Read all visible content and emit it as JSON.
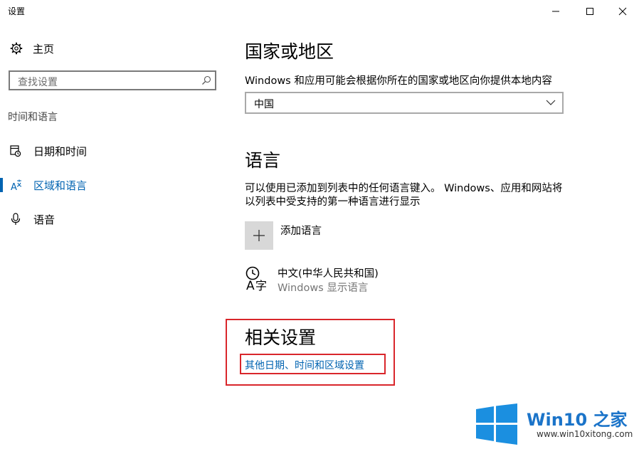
{
  "window": {
    "title": "设置",
    "controls": {
      "minimize": "minimize-icon",
      "maximize": "maximize-icon",
      "close": "close-icon"
    }
  },
  "sidebar": {
    "home_label": "主页",
    "search_placeholder": "查找设置",
    "section_title": "时间和语言",
    "items": [
      {
        "label": "日期和时间",
        "icon": "calendar-clock-icon",
        "active": false
      },
      {
        "label": "区域和语言",
        "icon": "language-region-icon",
        "active": true
      },
      {
        "label": "语音",
        "icon": "microphone-icon",
        "active": false
      }
    ]
  },
  "main": {
    "region": {
      "heading": "国家或地区",
      "description": "Windows 和应用可能会根据你所在的国家或地区向你提供本地内容",
      "selected_country": "中国"
    },
    "language": {
      "heading": "语言",
      "description": "可以使用已添加到列表中的任何语言键入。 Windows、应用和网站将以列表中受支持的第一种语言进行显示",
      "add_label": "添加语言",
      "installed": [
        {
          "name": "中文(中华人民共和国)",
          "sub": "Windows 显示语言"
        }
      ]
    },
    "related": {
      "heading": "相关设置",
      "link": "其他日期、时间和区域设置"
    }
  },
  "watermark": {
    "title_en": "Win10",
    "title_zh": "之家",
    "url": "www.win10xitong.com"
  },
  "colors": {
    "accent": "#0063b1",
    "highlight": "#d9262b"
  }
}
